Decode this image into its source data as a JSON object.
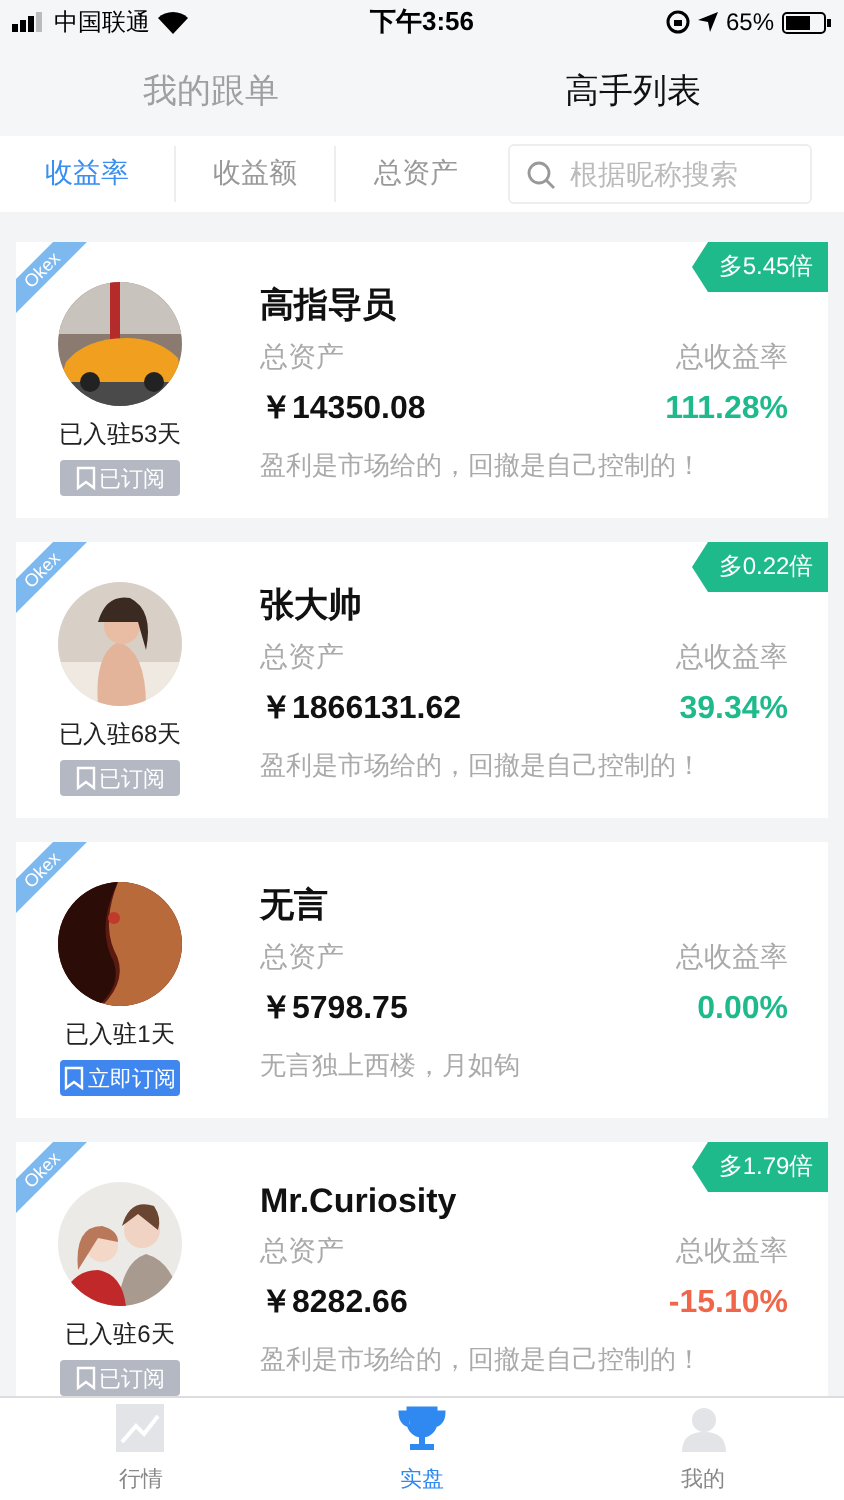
{
  "status_bar": {
    "carrier": "中国联通",
    "time": "下午3:56",
    "battery": "65%"
  },
  "top_tabs": [
    {
      "label": "我的跟单",
      "selected": false
    },
    {
      "label": "高手列表",
      "selected": true
    }
  ],
  "sort_tabs": [
    {
      "label": "收益率",
      "selected": true
    },
    {
      "label": "收益额",
      "selected": false
    },
    {
      "label": "总资产",
      "selected": false
    }
  ],
  "search": {
    "placeholder": "根据昵称搜索"
  },
  "traders": [
    {
      "exchange": "Okex",
      "name": "高指导员",
      "days": "已入驻53天",
      "subscribed": true,
      "subscribe_label": "已订阅",
      "badge": "多5.45倍",
      "assets_label": "总资产",
      "assets": "￥14350.08",
      "rate_label": "总收益率",
      "rate": "111.28%",
      "color": "#1fba8b",
      "motto": "盈利是市场给的，回撤是自己控制的！"
    },
    {
      "exchange": "Okex",
      "name": "张大帅",
      "days": "已入驻68天",
      "subscribed": true,
      "subscribe_label": "已订阅",
      "badge": "多0.22倍",
      "assets_label": "总资产",
      "assets": "￥1866131.62",
      "rate_label": "总收益率",
      "rate": "39.34%",
      "color": "#1fba8b",
      "motto": "盈利是市场给的，回撤是自己控制的！"
    },
    {
      "exchange": "Okex",
      "name": "无言",
      "days": "已入驻1天",
      "subscribed": false,
      "subscribe_label": "立即订阅",
      "assets_label": "总资产",
      "assets": "￥5798.75",
      "rate_label": "总收益率",
      "rate": "0.00%",
      "color": "#1fba8b",
      "motto": "无言独上西楼，月如钩"
    },
    {
      "exchange": "Okex",
      "name": "Mr.Curiosity",
      "days": "已入驻6天",
      "subscribed": true,
      "subscribe_label": "已订阅",
      "badge": "多1.79倍",
      "assets_label": "总资产",
      "assets": "￥8282.66",
      "rate_label": "总收益率",
      "rate": "-15.10%",
      "color": "#f0664a",
      "motto": "盈利是市场给的，回撤是自己控制的！"
    }
  ],
  "tab_bar": [
    {
      "label": "行情",
      "selected": false
    },
    {
      "label": "实盘",
      "selected": true
    },
    {
      "label": "我的",
      "selected": false
    }
  ]
}
